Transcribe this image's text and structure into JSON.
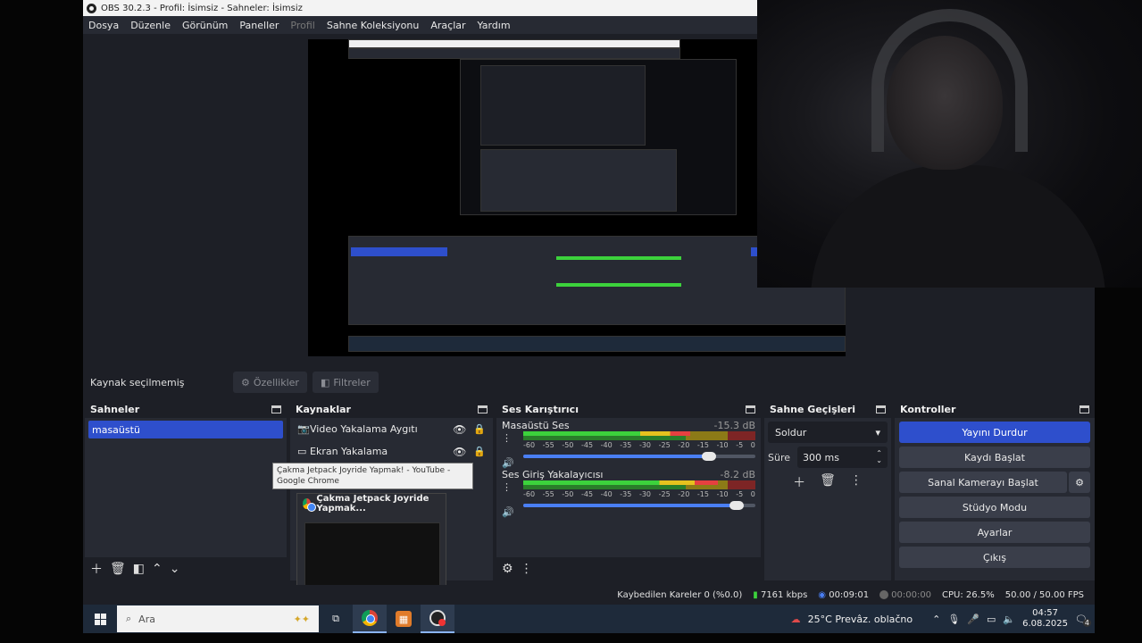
{
  "window": {
    "title": "OBS 30.2.3 - Profil: İsimsiz - Sahneler: İsimsiz"
  },
  "menu": [
    "Dosya",
    "Düzenle",
    "Görünüm",
    "Paneller",
    "Profil",
    "Sahne Koleksiyonu",
    "Araçlar",
    "Yardım"
  ],
  "source_bar": {
    "no_selection": "Kaynak seçilmemiş",
    "properties": "Özellikler",
    "filters": "Filtreler"
  },
  "scenes": {
    "title": "Sahneler",
    "items": [
      "masaüstü"
    ]
  },
  "sources": {
    "title": "Kaynaklar",
    "items": [
      {
        "label": "Video Yakalama Aygıtı",
        "icon": "camera-icon"
      },
      {
        "label": "Ekran Yakalama",
        "icon": "monitor-icon"
      }
    ]
  },
  "mixer": {
    "title": "Ses Karıştırıcı",
    "ticks": [
      "-60",
      "-55",
      "-50",
      "-45",
      "-40",
      "-35",
      "-30",
      "-25",
      "-20",
      "-15",
      "-10",
      "-5",
      "0"
    ],
    "channels": [
      {
        "name": "Masaüstü Ses",
        "db": "-15.3 dB",
        "level": 0.72,
        "volume": 0.8
      },
      {
        "name": "Ses Giriş Yakalayıcısı",
        "db": "-8.2 dB",
        "level": 0.84,
        "volume": 0.92
      }
    ]
  },
  "transitions": {
    "title": "Sahne Geçişleri",
    "selected": "Soldur",
    "duration_label": "Süre",
    "duration_value": "300 ms"
  },
  "controls": {
    "title": "Kontroller",
    "buttons": [
      "Yayını Durdur",
      "Kaydı Başlat",
      "Sanal Kamerayı Başlat",
      "Stüdyo Modu",
      "Ayarlar",
      "Çıkış"
    ]
  },
  "status": {
    "dropped": "Kaybedilen Kareler 0 (%0.0)",
    "bitrate": "7161 kbps",
    "stream_time": "00:09:01",
    "rec_time": "00:00:00",
    "cpu": "CPU: 26.5%",
    "fps": "50.00 / 50.00 FPS"
  },
  "tooltip": "Çakma Jetpack Joyride Yapmak! - YouTube - Google Chrome",
  "thumbnail_title": "Çakma Jetpack Joyride Yapmak...",
  "taskbar": {
    "search_placeholder": "Ara",
    "weather": "25°C  Prevâz. oblačno",
    "time": "04:57",
    "date": "6.08.2025",
    "notifications": "4"
  },
  "colors": {
    "accent": "#2e4fcc",
    "panel": "#272a33",
    "bg": "#1d1f26"
  }
}
